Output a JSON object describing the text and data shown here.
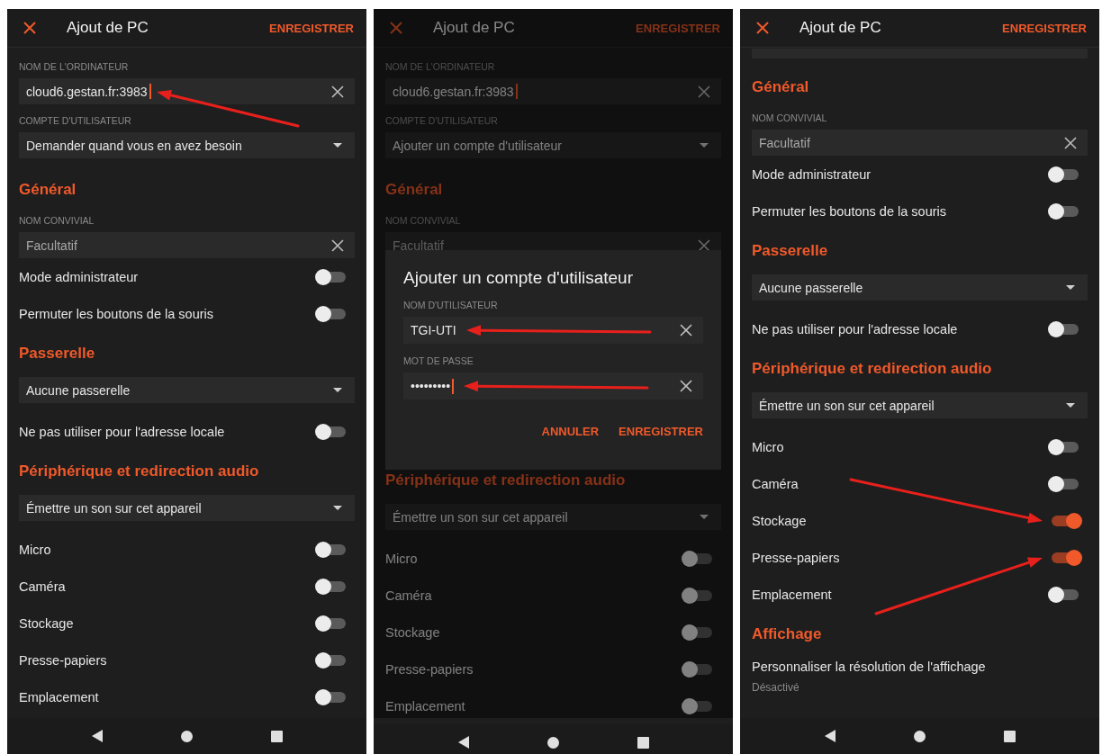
{
  "panels": [
    {
      "title": "Ajout de PC",
      "action": "ENREGISTRER",
      "dimmed": false,
      "items": [
        {
          "kind": "field",
          "label": "NOM DE L'ORDINATEUR",
          "value": "cloud6.gestan.fr:3983",
          "cursor": true,
          "arrow": {
            "kind": "left-up"
          }
        },
        {
          "kind": "dropdown",
          "label": "COMPTE D'UTILISATEUR",
          "value": "Demander quand vous en avez besoin"
        },
        {
          "kind": "section",
          "title": "Général"
        },
        {
          "kind": "field",
          "label": "NOM CONVIVIAL",
          "placeholder": "Facultatif"
        },
        {
          "kind": "toggle",
          "label": "Mode administrateur",
          "on": false
        },
        {
          "kind": "toggle",
          "label": "Permuter les boutons de la souris",
          "on": false
        },
        {
          "kind": "section",
          "title": "Passerelle"
        },
        {
          "kind": "dropdown",
          "value": "Aucune passerelle"
        },
        {
          "kind": "toggle",
          "label": "Ne pas utiliser pour l'adresse locale",
          "on": false
        },
        {
          "kind": "section",
          "title": "Périphérique et redirection audio"
        },
        {
          "kind": "dropdown",
          "value": "Émettre un son sur cet appareil"
        },
        {
          "kind": "toggle",
          "label": "Micro",
          "on": false
        },
        {
          "kind": "toggle",
          "label": "Caméra",
          "on": false
        },
        {
          "kind": "toggle",
          "label": "Stockage",
          "on": false
        },
        {
          "kind": "toggle",
          "label": "Presse-papiers",
          "on": false
        },
        {
          "kind": "toggle",
          "label": "Emplacement",
          "on": false
        }
      ]
    },
    {
      "title": "Ajout de PC",
      "action": "ENREGISTRER",
      "dimmed": true,
      "items": [
        {
          "kind": "field",
          "label": "NOM DE L'ORDINATEUR",
          "value": "cloud6.gestan.fr:3983",
          "cursor": true
        },
        {
          "kind": "dropdown",
          "label": "COMPTE D'UTILISATEUR",
          "value": "Ajouter un compte d'utilisateur"
        },
        {
          "kind": "section",
          "title": "Général"
        },
        {
          "kind": "field",
          "label": "NOM CONVIVIAL",
          "placeholder": "Facultatif"
        },
        {
          "kind": "dialog",
          "title": "Ajouter un compte d'utilisateur",
          "fields": [
            {
              "label": "NOM D'UTILISATEUR",
              "value": "TGI-UTI",
              "cursor": false,
              "arrow": {
                "kind": "left"
              }
            },
            {
              "label": "MOT DE PASSE",
              "value": "•••••••••",
              "cursor": true,
              "arrow": {
                "kind": "left"
              }
            }
          ],
          "buttons": [
            "ANNULER",
            "ENREGISTRER"
          ]
        },
        {
          "kind": "section",
          "title": "Périphérique et redirection audio"
        },
        {
          "kind": "dropdown",
          "value": "Émettre un son sur cet appareil"
        },
        {
          "kind": "toggle",
          "label": "Micro",
          "on": false
        },
        {
          "kind": "toggle",
          "label": "Caméra",
          "on": false
        },
        {
          "kind": "toggle",
          "label": "Stockage",
          "on": false
        },
        {
          "kind": "toggle",
          "label": "Presse-papiers",
          "on": false
        },
        {
          "kind": "toggle",
          "label": "Emplacement",
          "on": false
        }
      ]
    },
    {
      "title": "Ajout de PC",
      "action": "ENREGISTRER",
      "dimmed": false,
      "items": [
        {
          "kind": "field-edge"
        },
        {
          "kind": "section",
          "title": "Général"
        },
        {
          "kind": "field",
          "label": "NOM CONVIVIAL",
          "placeholder": "Facultatif"
        },
        {
          "kind": "toggle",
          "label": "Mode administrateur",
          "on": false
        },
        {
          "kind": "toggle",
          "label": "Permuter les boutons de la souris",
          "on": false
        },
        {
          "kind": "section",
          "title": "Passerelle"
        },
        {
          "kind": "dropdown",
          "value": "Aucune passerelle"
        },
        {
          "kind": "toggle",
          "label": "Ne pas utiliser pour l'adresse locale",
          "on": false
        },
        {
          "kind": "section",
          "title": "Périphérique et redirection audio"
        },
        {
          "kind": "dropdown",
          "value": "Émettre un son sur cet appareil"
        },
        {
          "kind": "toggle",
          "label": "Micro",
          "on": false
        },
        {
          "kind": "toggle",
          "label": "Caméra",
          "on": false
        },
        {
          "kind": "toggle",
          "label": "Stockage",
          "on": true,
          "arrow": {
            "kind": "down-right"
          }
        },
        {
          "kind": "toggle",
          "label": "Presse-papiers",
          "on": true,
          "arrow": {
            "kind": "up-right"
          }
        },
        {
          "kind": "toggle",
          "label": "Emplacement",
          "on": false
        },
        {
          "kind": "section",
          "title": "Affichage"
        },
        {
          "kind": "setting",
          "title": "Personnaliser la résolution de l'affichage",
          "subtitle": "Désactivé"
        }
      ]
    }
  ]
}
